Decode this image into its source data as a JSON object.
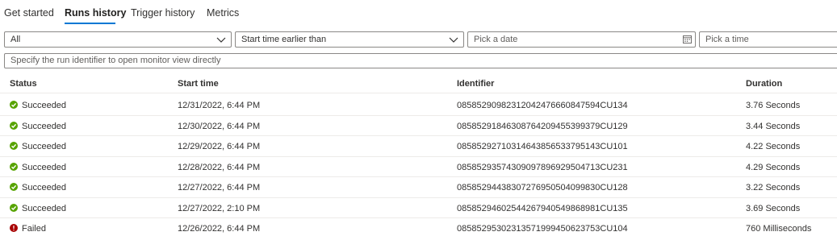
{
  "tabs": [
    {
      "label": "Get started"
    },
    {
      "label": "Runs history"
    },
    {
      "label": "Trigger history"
    },
    {
      "label": "Metrics"
    }
  ],
  "filters": {
    "status_value": "All",
    "start_value": "Start time earlier than",
    "date_placeholder": "Pick a date",
    "time_placeholder": "Pick a time"
  },
  "run_id_placeholder": "Specify the run identifier to open monitor view directly",
  "columns": {
    "status": "Status",
    "start": "Start time",
    "id": "Identifier",
    "duration": "Duration"
  },
  "colors": {
    "accent": "#0078d4",
    "succeeded": "#57a300",
    "failed": "#a80000"
  },
  "rows": [
    {
      "status": "Succeeded",
      "icon": "check-circle-icon",
      "start": "12/31/2022, 6:44 PM",
      "id": "08585290982312042476660847594CU134",
      "duration": "3.76 Seconds"
    },
    {
      "status": "Succeeded",
      "icon": "check-circle-icon",
      "start": "12/30/2022, 6:44 PM",
      "id": "08585291846308764209455399379CU129",
      "duration": "3.44 Seconds"
    },
    {
      "status": "Succeeded",
      "icon": "check-circle-icon",
      "start": "12/29/2022, 6:44 PM",
      "id": "08585292710314643856533795143CU101",
      "duration": "4.22 Seconds"
    },
    {
      "status": "Succeeded",
      "icon": "check-circle-icon",
      "start": "12/28/2022, 6:44 PM",
      "id": "08585293574309097896929504713CU231",
      "duration": "4.29 Seconds"
    },
    {
      "status": "Succeeded",
      "icon": "check-circle-icon",
      "start": "12/27/2022, 6:44 PM",
      "id": "08585294438307276950504099830CU128",
      "duration": "3.22 Seconds"
    },
    {
      "status": "Succeeded",
      "icon": "check-circle-icon",
      "start": "12/27/2022, 2:10 PM",
      "id": "08585294602544267940549868981CU135",
      "duration": "3.69 Seconds"
    },
    {
      "status": "Failed",
      "icon": "error-circle-icon",
      "start": "12/26/2022, 6:44 PM",
      "id": "08585295302313571999450623753CU104",
      "duration": "760 Milliseconds"
    }
  ]
}
